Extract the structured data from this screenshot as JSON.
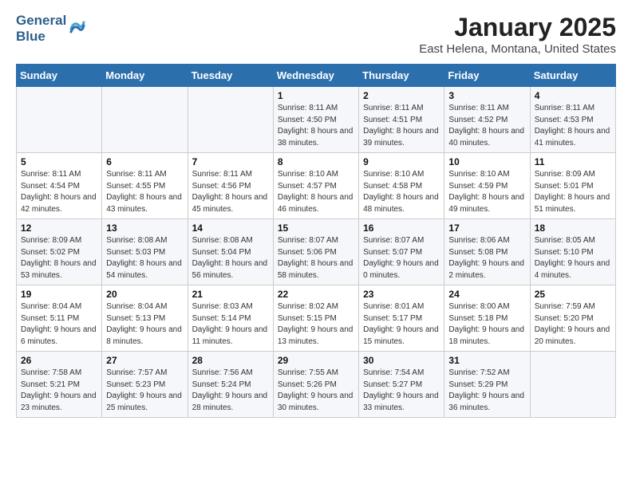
{
  "logo": {
    "line1": "General",
    "line2": "Blue"
  },
  "title": "January 2025",
  "subtitle": "East Helena, Montana, United States",
  "weekdays": [
    "Sunday",
    "Monday",
    "Tuesday",
    "Wednesday",
    "Thursday",
    "Friday",
    "Saturday"
  ],
  "weeks": [
    [
      {
        "day": "",
        "info": ""
      },
      {
        "day": "",
        "info": ""
      },
      {
        "day": "",
        "info": ""
      },
      {
        "day": "1",
        "info": "Sunrise: 8:11 AM\nSunset: 4:50 PM\nDaylight: 8 hours and 38 minutes."
      },
      {
        "day": "2",
        "info": "Sunrise: 8:11 AM\nSunset: 4:51 PM\nDaylight: 8 hours and 39 minutes."
      },
      {
        "day": "3",
        "info": "Sunrise: 8:11 AM\nSunset: 4:52 PM\nDaylight: 8 hours and 40 minutes."
      },
      {
        "day": "4",
        "info": "Sunrise: 8:11 AM\nSunset: 4:53 PM\nDaylight: 8 hours and 41 minutes."
      }
    ],
    [
      {
        "day": "5",
        "info": "Sunrise: 8:11 AM\nSunset: 4:54 PM\nDaylight: 8 hours and 42 minutes."
      },
      {
        "day": "6",
        "info": "Sunrise: 8:11 AM\nSunset: 4:55 PM\nDaylight: 8 hours and 43 minutes."
      },
      {
        "day": "7",
        "info": "Sunrise: 8:11 AM\nSunset: 4:56 PM\nDaylight: 8 hours and 45 minutes."
      },
      {
        "day": "8",
        "info": "Sunrise: 8:10 AM\nSunset: 4:57 PM\nDaylight: 8 hours and 46 minutes."
      },
      {
        "day": "9",
        "info": "Sunrise: 8:10 AM\nSunset: 4:58 PM\nDaylight: 8 hours and 48 minutes."
      },
      {
        "day": "10",
        "info": "Sunrise: 8:10 AM\nSunset: 4:59 PM\nDaylight: 8 hours and 49 minutes."
      },
      {
        "day": "11",
        "info": "Sunrise: 8:09 AM\nSunset: 5:01 PM\nDaylight: 8 hours and 51 minutes."
      }
    ],
    [
      {
        "day": "12",
        "info": "Sunrise: 8:09 AM\nSunset: 5:02 PM\nDaylight: 8 hours and 53 minutes."
      },
      {
        "day": "13",
        "info": "Sunrise: 8:08 AM\nSunset: 5:03 PM\nDaylight: 8 hours and 54 minutes."
      },
      {
        "day": "14",
        "info": "Sunrise: 8:08 AM\nSunset: 5:04 PM\nDaylight: 8 hours and 56 minutes."
      },
      {
        "day": "15",
        "info": "Sunrise: 8:07 AM\nSunset: 5:06 PM\nDaylight: 8 hours and 58 minutes."
      },
      {
        "day": "16",
        "info": "Sunrise: 8:07 AM\nSunset: 5:07 PM\nDaylight: 9 hours and 0 minutes."
      },
      {
        "day": "17",
        "info": "Sunrise: 8:06 AM\nSunset: 5:08 PM\nDaylight: 9 hours and 2 minutes."
      },
      {
        "day": "18",
        "info": "Sunrise: 8:05 AM\nSunset: 5:10 PM\nDaylight: 9 hours and 4 minutes."
      }
    ],
    [
      {
        "day": "19",
        "info": "Sunrise: 8:04 AM\nSunset: 5:11 PM\nDaylight: 9 hours and 6 minutes."
      },
      {
        "day": "20",
        "info": "Sunrise: 8:04 AM\nSunset: 5:13 PM\nDaylight: 9 hours and 8 minutes."
      },
      {
        "day": "21",
        "info": "Sunrise: 8:03 AM\nSunset: 5:14 PM\nDaylight: 9 hours and 11 minutes."
      },
      {
        "day": "22",
        "info": "Sunrise: 8:02 AM\nSunset: 5:15 PM\nDaylight: 9 hours and 13 minutes."
      },
      {
        "day": "23",
        "info": "Sunrise: 8:01 AM\nSunset: 5:17 PM\nDaylight: 9 hours and 15 minutes."
      },
      {
        "day": "24",
        "info": "Sunrise: 8:00 AM\nSunset: 5:18 PM\nDaylight: 9 hours and 18 minutes."
      },
      {
        "day": "25",
        "info": "Sunrise: 7:59 AM\nSunset: 5:20 PM\nDaylight: 9 hours and 20 minutes."
      }
    ],
    [
      {
        "day": "26",
        "info": "Sunrise: 7:58 AM\nSunset: 5:21 PM\nDaylight: 9 hours and 23 minutes."
      },
      {
        "day": "27",
        "info": "Sunrise: 7:57 AM\nSunset: 5:23 PM\nDaylight: 9 hours and 25 minutes."
      },
      {
        "day": "28",
        "info": "Sunrise: 7:56 AM\nSunset: 5:24 PM\nDaylight: 9 hours and 28 minutes."
      },
      {
        "day": "29",
        "info": "Sunrise: 7:55 AM\nSunset: 5:26 PM\nDaylight: 9 hours and 30 minutes."
      },
      {
        "day": "30",
        "info": "Sunrise: 7:54 AM\nSunset: 5:27 PM\nDaylight: 9 hours and 33 minutes."
      },
      {
        "day": "31",
        "info": "Sunrise: 7:52 AM\nSunset: 5:29 PM\nDaylight: 9 hours and 36 minutes."
      },
      {
        "day": "",
        "info": ""
      }
    ]
  ]
}
